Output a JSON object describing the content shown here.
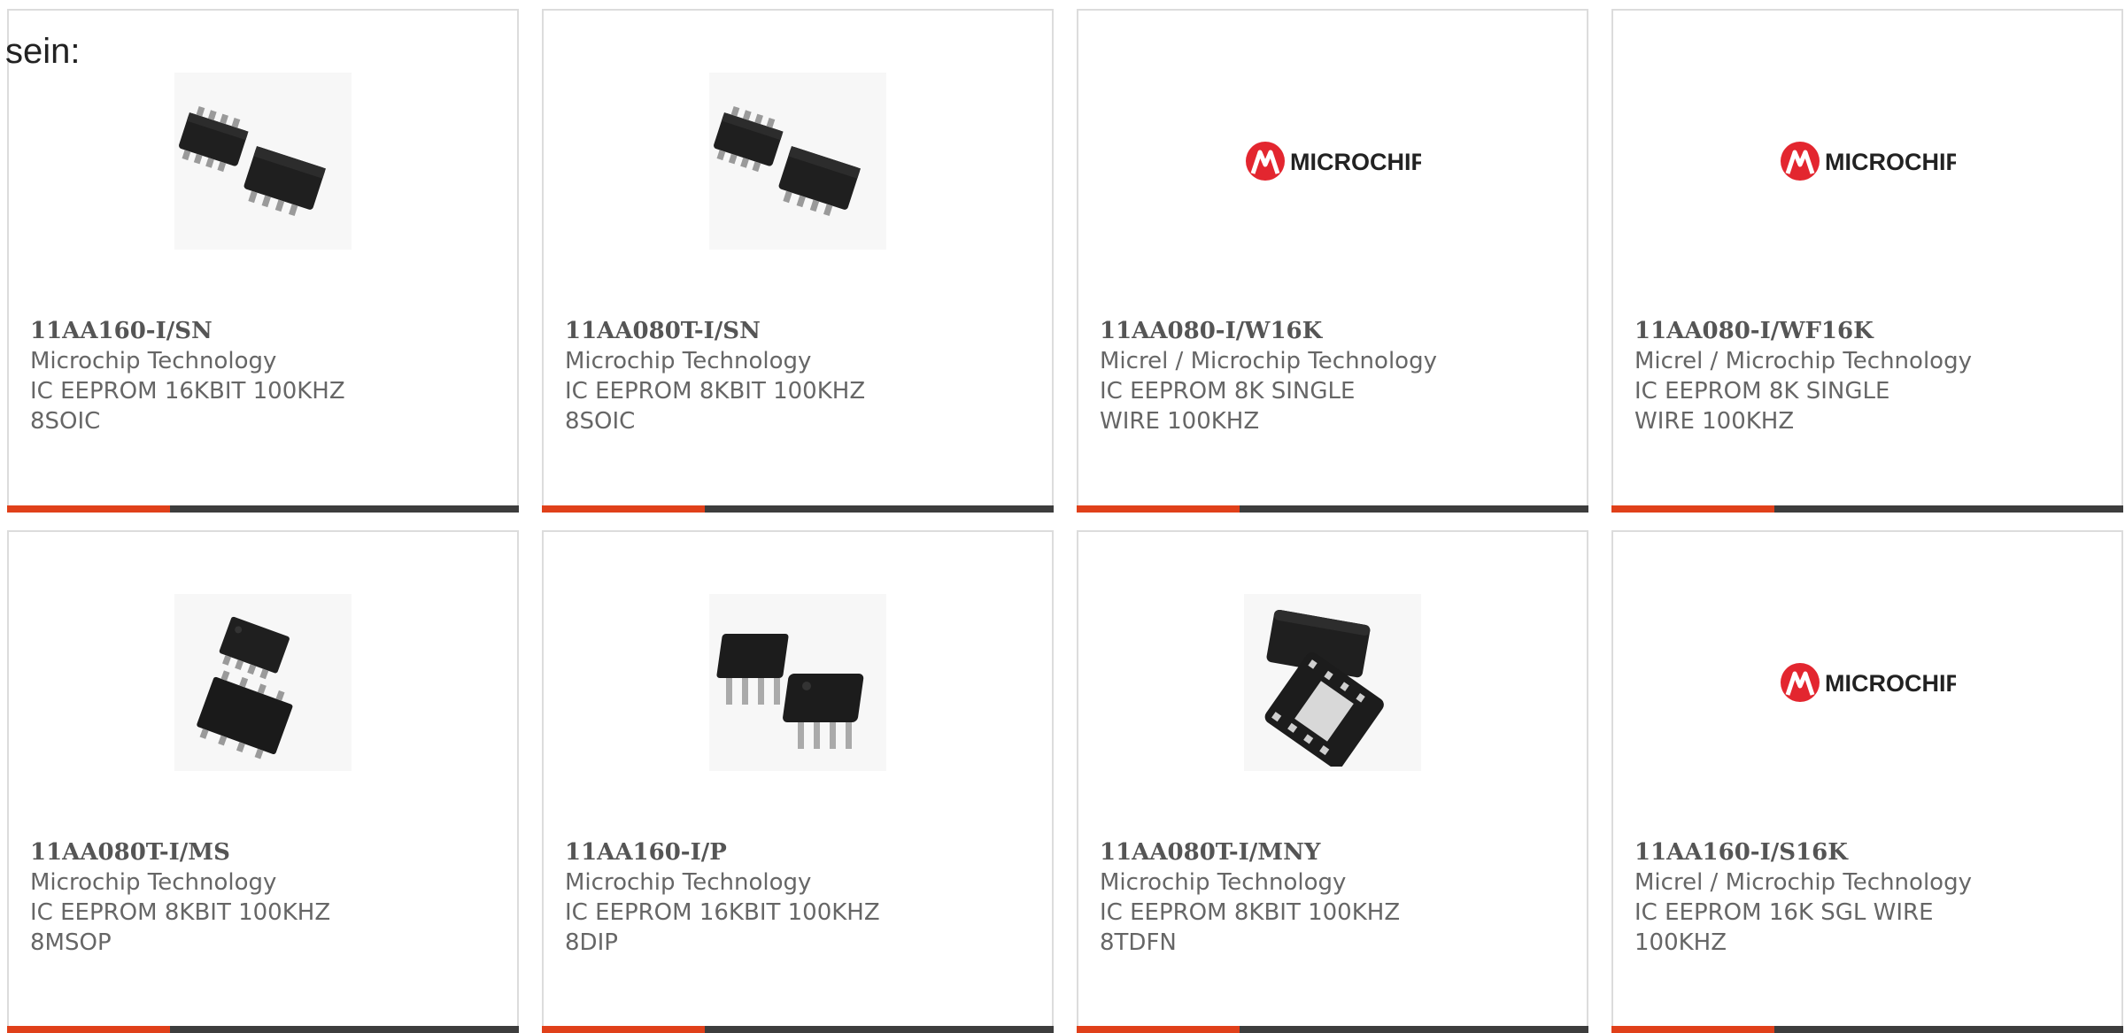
{
  "intro_text": "sein:",
  "colors": {
    "accent": "#e0401a",
    "bar_dark": "#3d3d3d",
    "microchip_red": "#e3262f"
  },
  "products": [
    {
      "part_number": "11AA160-I/SN",
      "manufacturer": "Microchip Technology",
      "description": "IC EEPROM 16KBIT 100KHZ 8SOIC",
      "image": "soic-8-package"
    },
    {
      "part_number": "11AA080T-I/SN",
      "manufacturer": "Microchip Technology",
      "description": "IC EEPROM 8KBIT 100KHZ 8SOIC",
      "image": "soic-8-package"
    },
    {
      "part_number": "11AA080-I/W16K",
      "manufacturer": "Micrel / Microchip Technology",
      "description": "IC EEPROM 8K SINGLE WIRE 100KHZ",
      "image": "microchip-logo",
      "logo_text": "MICROCHIP"
    },
    {
      "part_number": "11AA080-I/WF16K",
      "manufacturer": "Micrel / Microchip Technology",
      "description": "IC EEPROM 8K SINGLE WIRE 100KHZ",
      "image": "microchip-logo",
      "logo_text": "MICROCHIP"
    },
    {
      "part_number": "11AA080T-I/MS",
      "manufacturer": "Microchip Technology",
      "description": "IC EEPROM 8KBIT 100KHZ 8MSOP",
      "image": "msop-8-package"
    },
    {
      "part_number": "11AA160-I/P",
      "manufacturer": "Microchip Technology",
      "description": "IC EEPROM 16KBIT 100KHZ 8DIP",
      "image": "dip-8-package"
    },
    {
      "part_number": "11AA080T-I/MNY",
      "manufacturer": "Microchip Technology",
      "description": "IC EEPROM 8KBIT 100KHZ 8TDFN",
      "image": "tdfn-8-package"
    },
    {
      "part_number": "11AA160-I/S16K",
      "manufacturer": "Micrel / Microchip Technology",
      "description": "IC EEPROM 16K SGL WIRE 100KHZ",
      "image": "microchip-logo",
      "logo_text": "MICROCHIP"
    }
  ]
}
